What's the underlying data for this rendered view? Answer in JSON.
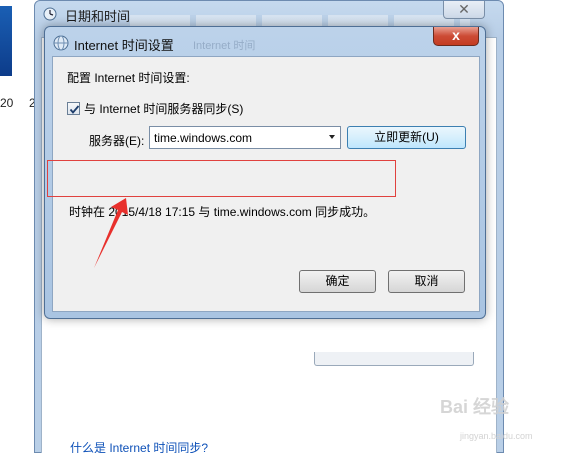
{
  "desktop": {
    "left_numbers": [
      "20",
      "2"
    ]
  },
  "background_window": {
    "title": "日期和时间",
    "close_symbol": "✕",
    "link_text": "什么是 Internet 时间同步?"
  },
  "dialog": {
    "title": "Internet 时间设置",
    "ghost_title": "Internet 时间",
    "close_symbol": "x",
    "heading": "配置 Internet 时间设置:",
    "sync_checkbox": {
      "label": "与 Internet 时间服务器同步(S)",
      "checked": true
    },
    "server": {
      "label": "服务器(E):",
      "value": "time.windows.com"
    },
    "update_button": "立即更新(U)",
    "status_message": "时钟在 2015/4/18 17:15 与 time.windows.com 同步成功。",
    "ok_button": "确定",
    "cancel_button": "取消"
  },
  "annotation": {
    "highlight_color": "#e0413e"
  },
  "watermark": {
    "text": "Bai 经验",
    "sub": "jingyan.baidu.com"
  },
  "icons": [
    "clock-globe-icon",
    "checkmark-icon",
    "dropdown-arrow-icon",
    "annotation-arrow-icon"
  ]
}
